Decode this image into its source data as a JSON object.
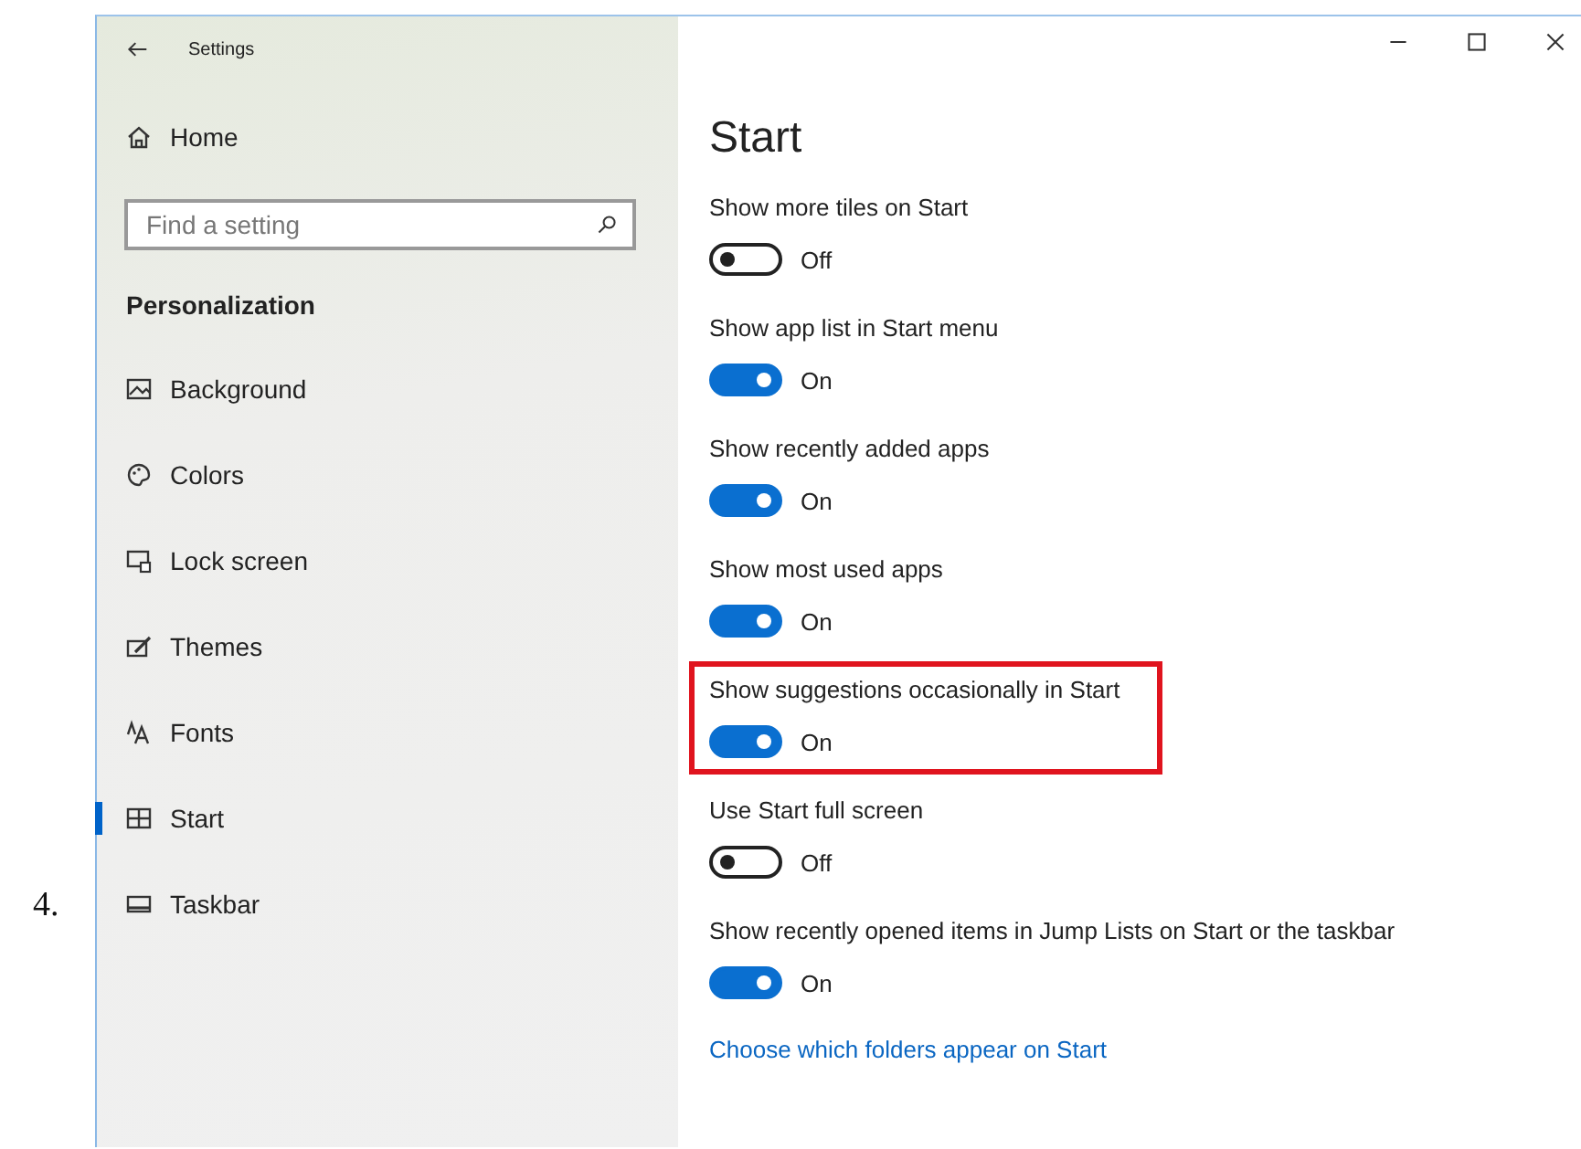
{
  "list_number": "4.",
  "window": {
    "title": "Settings"
  },
  "sidebar": {
    "home": "Home",
    "search": {
      "placeholder": "Find a setting"
    },
    "section": "Personalization",
    "items": [
      {
        "label": "Background",
        "selected": false
      },
      {
        "label": "Colors",
        "selected": false
      },
      {
        "label": "Lock screen",
        "selected": false
      },
      {
        "label": "Themes",
        "selected": false
      },
      {
        "label": "Fonts",
        "selected": false
      },
      {
        "label": "Start",
        "selected": true
      },
      {
        "label": "Taskbar",
        "selected": false
      }
    ]
  },
  "page": {
    "title": "Start",
    "settings": [
      {
        "label": "Show more tiles on Start",
        "on": false,
        "state": "Off",
        "highlighted": false
      },
      {
        "label": "Show app list in Start menu",
        "on": true,
        "state": "On",
        "highlighted": false
      },
      {
        "label": "Show recently added apps",
        "on": true,
        "state": "On",
        "highlighted": false
      },
      {
        "label": "Show most used apps",
        "on": true,
        "state": "On",
        "highlighted": false
      },
      {
        "label": "Show suggestions occasionally in Start",
        "on": true,
        "state": "On",
        "highlighted": true
      },
      {
        "label": "Use Start full screen",
        "on": false,
        "state": "Off",
        "highlighted": false
      },
      {
        "label": "Show recently opened items in Jump Lists on Start or the taskbar",
        "on": true,
        "state": "On",
        "highlighted": false
      }
    ],
    "link": "Choose which folders appear on Start"
  }
}
